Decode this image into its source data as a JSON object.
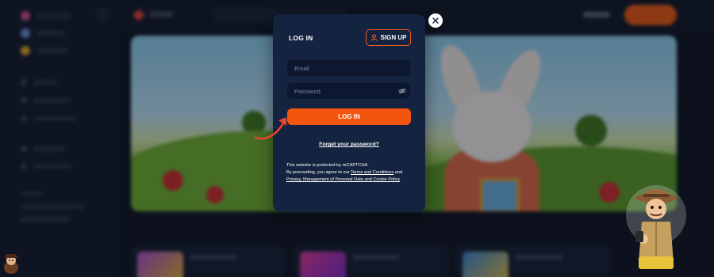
{
  "modal": {
    "tab_login": "LOG IN",
    "tab_signup": "SIGN UP",
    "email_placeholder": "Email",
    "password_placeholder": "Password",
    "submit_label": "LOG IN",
    "forgot_label": "Forget your password?",
    "recaptcha_text": "This website is protected by reCAPTCHA.",
    "agree_prefix": "By proceeding, you agree to our ",
    "terms_link": "Terms and Conditions",
    "agree_and": " and",
    "privacy_link": "Privacy, Management of Personal Data and Cookie Policy"
  },
  "colors": {
    "accent": "#f3550f",
    "modal_bg": "#14233f",
    "field_bg": "#0d1830",
    "page_bg": "#101624"
  },
  "icons": [
    "close-icon",
    "user-icon",
    "eye-off-icon",
    "curved-arrow-icon",
    "detective-mascot-icon",
    "mascot-avatar-icon"
  ]
}
